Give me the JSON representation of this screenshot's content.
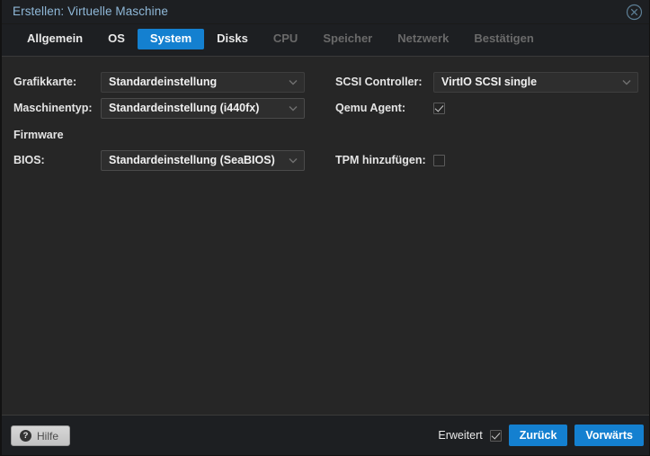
{
  "window": {
    "title": "Erstellen: Virtuelle Maschine",
    "close_icon": "close-circle-icon"
  },
  "tabs": [
    {
      "label": "Allgemein",
      "state": "normal"
    },
    {
      "label": "OS",
      "state": "normal"
    },
    {
      "label": "System",
      "state": "active"
    },
    {
      "label": "Disks",
      "state": "normal"
    },
    {
      "label": "CPU",
      "state": "disabled"
    },
    {
      "label": "Speicher",
      "state": "disabled"
    },
    {
      "label": "Netzwerk",
      "state": "disabled"
    },
    {
      "label": "Bestätigen",
      "state": "disabled"
    }
  ],
  "form": {
    "left": {
      "grafikkarte": {
        "label": "Grafikkarte:",
        "value": "Standardeinstellung"
      },
      "maschinentyp": {
        "label": "Maschinentyp:",
        "value": "Standardeinstellung (i440fx)"
      },
      "firmware_heading": "Firmware",
      "bios": {
        "label": "BIOS:",
        "value": "Standardeinstellung (SeaBIOS)"
      }
    },
    "right": {
      "scsi_controller": {
        "label": "SCSI Controller:",
        "value": "VirtIO SCSI single"
      },
      "qemu_agent": {
        "label": "Qemu Agent:",
        "checked": true
      },
      "tpm": {
        "label": "TPM hinzufügen:",
        "checked": false
      }
    }
  },
  "footer": {
    "help_label": "Hilfe",
    "help_icon_glyph": "?",
    "advanced_label": "Erweitert",
    "advanced_checked": true,
    "back_label": "Zurück",
    "next_label": "Vorwärts"
  },
  "colors": {
    "accent": "#1480d0",
    "title_text": "#8fb8d8",
    "body_bg": "#262626",
    "chrome_bg": "#1d1f22"
  }
}
